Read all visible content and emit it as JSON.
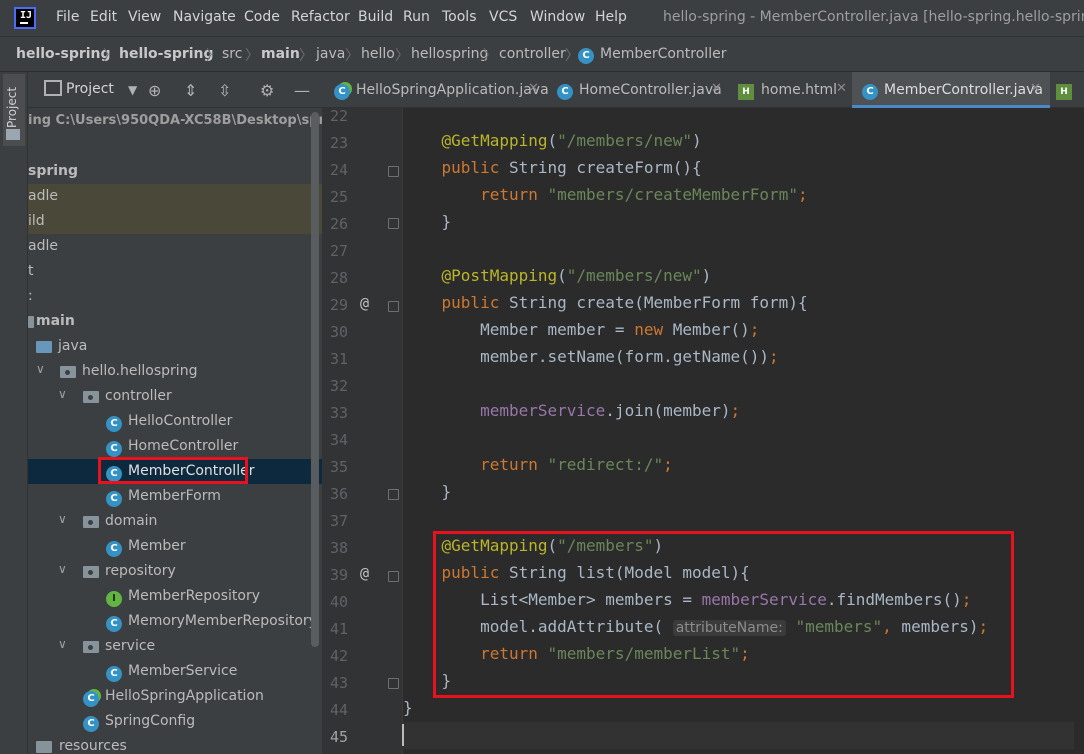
{
  "menubar": {
    "items": [
      "File",
      "Edit",
      "View",
      "Navigate",
      "Code",
      "Refactor",
      "Build",
      "Run",
      "Tools",
      "VCS",
      "Window",
      "Help"
    ],
    "window_title": "hello-spring - MemberController.java [hello-spring.hello-spring.main"
  },
  "breadcrumb": [
    "hello-spring",
    "hello-spring",
    "src",
    "main",
    "java",
    "hello",
    "hellospring",
    "controller",
    "MemberController"
  ],
  "left_stripe": {
    "label": "Project"
  },
  "project_panel": {
    "title": "Project",
    "tree": [
      {
        "label": "ing  C:\\Users\\950QDA-XC58B\\Desktop\\spri",
        "style": "path"
      },
      {
        "label": ""
      },
      {
        "label": "spring",
        "style": "bold"
      },
      {
        "label": "adle",
        "style": "hl"
      },
      {
        "label": "ild",
        "style": "hl"
      },
      {
        "label": "adle"
      },
      {
        "label": "t"
      },
      {
        "label": ":"
      },
      {
        "label": "main",
        "style": "bold"
      },
      {
        "label": "java"
      },
      {
        "label": "hello.hellospring"
      },
      {
        "label": "controller"
      },
      {
        "label": "HelloController"
      },
      {
        "label": "HomeController"
      },
      {
        "label": "MemberController",
        "style": "sel"
      },
      {
        "label": "MemberForm"
      },
      {
        "label": "domain"
      },
      {
        "label": "Member"
      },
      {
        "label": "repository"
      },
      {
        "label": "MemberRepository"
      },
      {
        "label": "MemoryMemberRepository"
      },
      {
        "label": "service"
      },
      {
        "label": "MemberService"
      },
      {
        "label": "HelloSpringApplication"
      },
      {
        "label": "SpringConfig"
      },
      {
        "label": "resources"
      }
    ]
  },
  "editor_tabs": [
    {
      "label": "HelloSpringApplication.java",
      "icon": "spring-class-icon",
      "active": false
    },
    {
      "label": "HomeController.java",
      "icon": "class-icon",
      "active": false
    },
    {
      "label": "home.html",
      "icon": "html-file-icon",
      "active": false
    },
    {
      "label": "MemberController.java",
      "icon": "class-icon",
      "active": true
    }
  ],
  "editor": {
    "line_numbers": [
      "22",
      "23",
      "24",
      "25",
      "26",
      "27",
      "28",
      "29",
      "30",
      "31",
      "32",
      "33",
      "34",
      "35",
      "36",
      "37",
      "38",
      "39",
      "40",
      "41",
      "42",
      "43",
      "44",
      "45"
    ],
    "inlay_hint": "attributeName:",
    "colors": {
      "keyword": "#cc7832",
      "annotation": "#bbb529",
      "string": "#6a8759",
      "field": "#9876aa",
      "highlight_box": "#e8121f"
    }
  }
}
